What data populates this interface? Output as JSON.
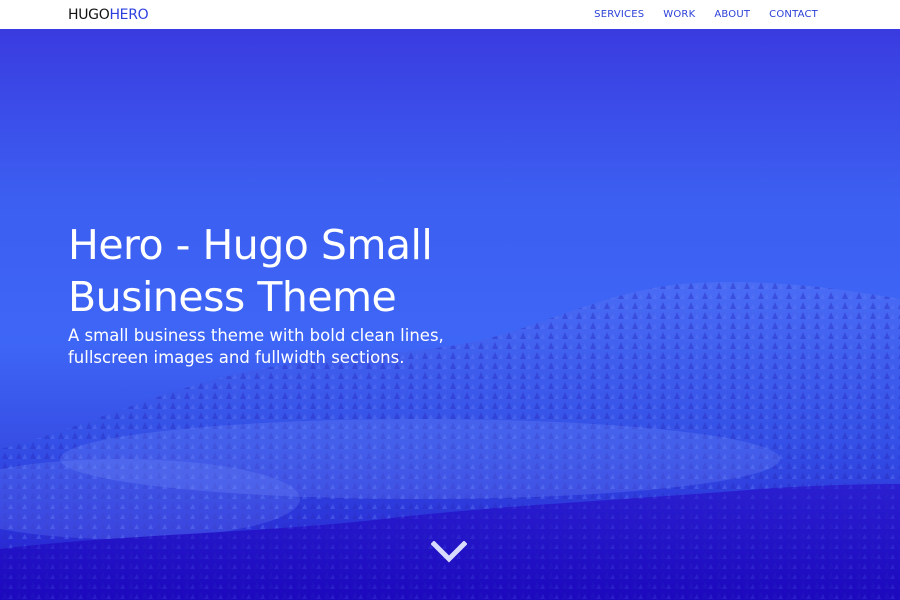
{
  "header": {
    "brand_part1": "HUGO",
    "brand_part2": "HERO",
    "nav": [
      {
        "label": "SERVICES"
      },
      {
        "label": "WORK"
      },
      {
        "label": "ABOUT"
      },
      {
        "label": "CONTACT"
      }
    ]
  },
  "hero": {
    "title": "Hero - Hugo Small Business Theme",
    "subtitle": "A small business theme with bold clean lines, fullscreen images and fullwidth sections.",
    "scroll_icon": "chevron-down-icon"
  },
  "colors": {
    "brand_accent": "#2a3fe0",
    "hero_overlay": "#3a5df0",
    "hero_dark": "#2010c8",
    "text_on_hero": "#ffffff"
  }
}
